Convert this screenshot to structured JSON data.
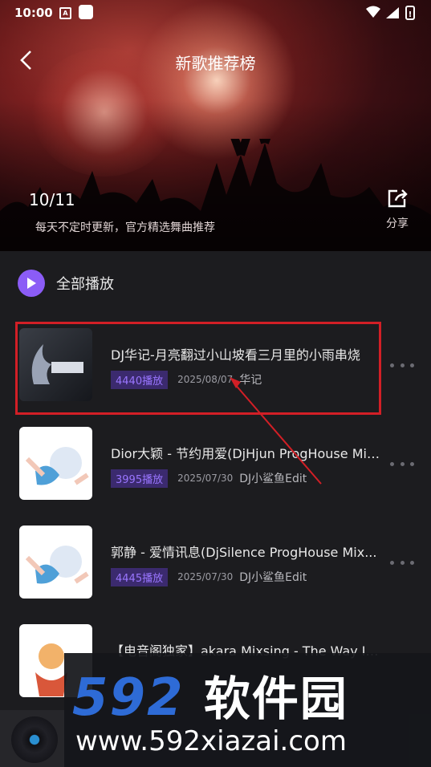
{
  "status_bar": {
    "time": "10:00",
    "notif_icon_label": "A"
  },
  "header": {
    "title": "新歌推荐榜",
    "date": "10/11",
    "subtitle": "每天不定时更新，官方精选舞曲推荐",
    "share_label": "分享"
  },
  "play_all": {
    "label": "全部播放"
  },
  "songs": [
    {
      "title": "DJ华记-月亮翻过小山坡看三月里的小雨串烧",
      "plays": "4440播放",
      "date": "2025/08/07",
      "artist": "华记"
    },
    {
      "title": "Dior大颖 - 节约用爱(DjHjun ProgHouse Mix...",
      "plays": "3995播放",
      "date": "2025/07/30",
      "artist": "DJ小鲨鱼Edit"
    },
    {
      "title": "郭静 - 爱情讯息(DjSilence ProgHouse Mix...",
      "plays": "4445播放",
      "date": "2025/07/30",
      "artist": "DJ小鲨鱼Edit"
    },
    {
      "title": "【电音阁独家】akara Mixsing - The Way I A...",
      "plays": "",
      "date": "",
      "artist": ""
    }
  ],
  "watermark": {
    "logo_num": "592",
    "logo_cn": "软件园",
    "url": "www.592xiazai.com"
  },
  "colors": {
    "accent": "#8b5cf6",
    "highlight": "#d21f26",
    "bg": "#1c1c1f"
  }
}
